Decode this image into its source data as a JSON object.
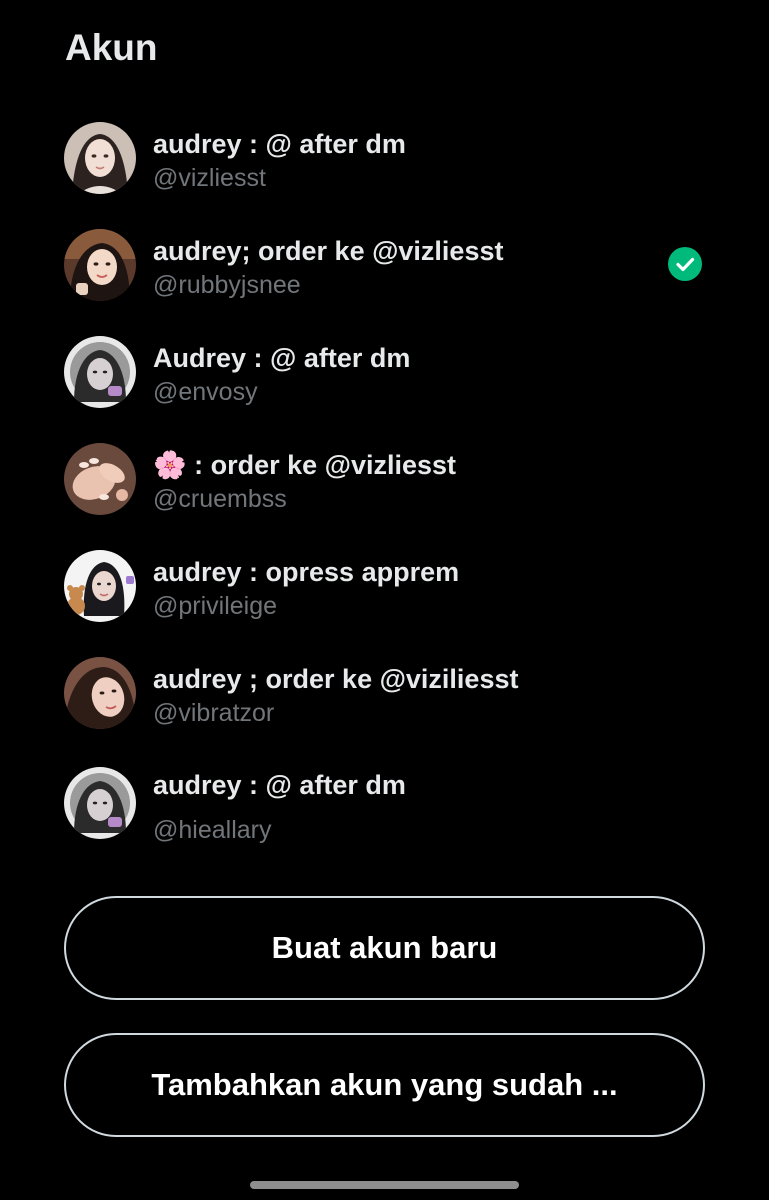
{
  "header": {
    "title": "Akun"
  },
  "accounts": [
    {
      "name": "audrey : @ after dm",
      "handle": "@vizliesst",
      "selected": false
    },
    {
      "name": "audrey; order ke @vizliesst",
      "handle": "@rubbyjsnee",
      "selected": true
    },
    {
      "name": "Audrey : @ after dm",
      "handle": "@envosy",
      "selected": false
    },
    {
      "name": "🌸 : order ke @vizliesst",
      "handle": "@cruembss",
      "selected": false
    },
    {
      "name": "audrey : opress apprem",
      "handle": "@privileige",
      "selected": false
    },
    {
      "name": "audrey ; order ke @viziliesst",
      "handle": "@vibratzor",
      "selected": false
    },
    {
      "name": "audrey : @ after dm",
      "handle": "@hieallary",
      "selected": false
    }
  ],
  "buttons": {
    "create_account": "Buat akun baru",
    "add_existing": "Tambahkan akun yang sudah ..."
  },
  "colors": {
    "background": "#000000",
    "primary_text": "#e7e9ea",
    "secondary_text": "#71767b",
    "selected_check": "#00ba7c",
    "button_border": "#cfd9de"
  },
  "icons": {
    "selected_indicator": "check-circle-icon"
  }
}
